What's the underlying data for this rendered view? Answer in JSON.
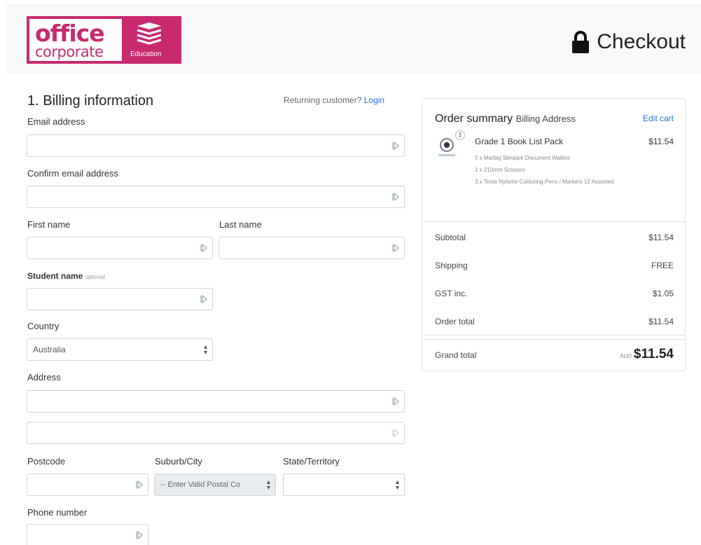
{
  "header": {
    "logo_word1": "office",
    "logo_word2": "corporate",
    "logo_tag": "Education",
    "title": "Checkout",
    "brand_color": "#c8296f"
  },
  "billing": {
    "title": "1. Billing information",
    "returning_text": "Returning customer?",
    "login_label": "Login",
    "email_label": "Email address",
    "confirm_email_label": "Confirm email address",
    "first_name_label": "First name",
    "last_name_label": "Last name",
    "student_name_label": "Student name",
    "optional_label": "optional",
    "country_label": "Country",
    "country_value": "Australia",
    "address_label": "Address",
    "postcode_label": "Postcode",
    "suburb_label": "Suburb/City",
    "suburb_placeholder": "-- Enter Valid Postal Co",
    "state_label": "State/Territory",
    "state_value": "",
    "phone_label": "Phone number"
  },
  "summary": {
    "title": "Order summary",
    "subtitle": "Billing Address",
    "edit_label": "Edit cart",
    "quantity": "1",
    "product_name": "Grade 1 Book List Pack",
    "product_price": "$11.54",
    "items": [
      "5 x Marbig Slimpick Document Wallets",
      "1 x 210mm Scissors",
      "3 x Texta Nylorite Colouring Pens / Markers 12 Assorted"
    ],
    "subtotal_label": "Subtotal",
    "subtotal_value": "$11.54",
    "shipping_label": "Shipping",
    "shipping_value": "FREE",
    "gst_label": "GST inc.",
    "gst_value": "$1.05",
    "order_total_label": "Order total",
    "order_total_value": "$11.54",
    "grand_total_label": "Grand total",
    "currency": "AUD",
    "grand_total_value": "$11.54"
  },
  "icons": {
    "lock": "lock-icon",
    "autofill": "autofill-icon",
    "select_caret": "select-caret-icon",
    "books": "books-icon"
  }
}
